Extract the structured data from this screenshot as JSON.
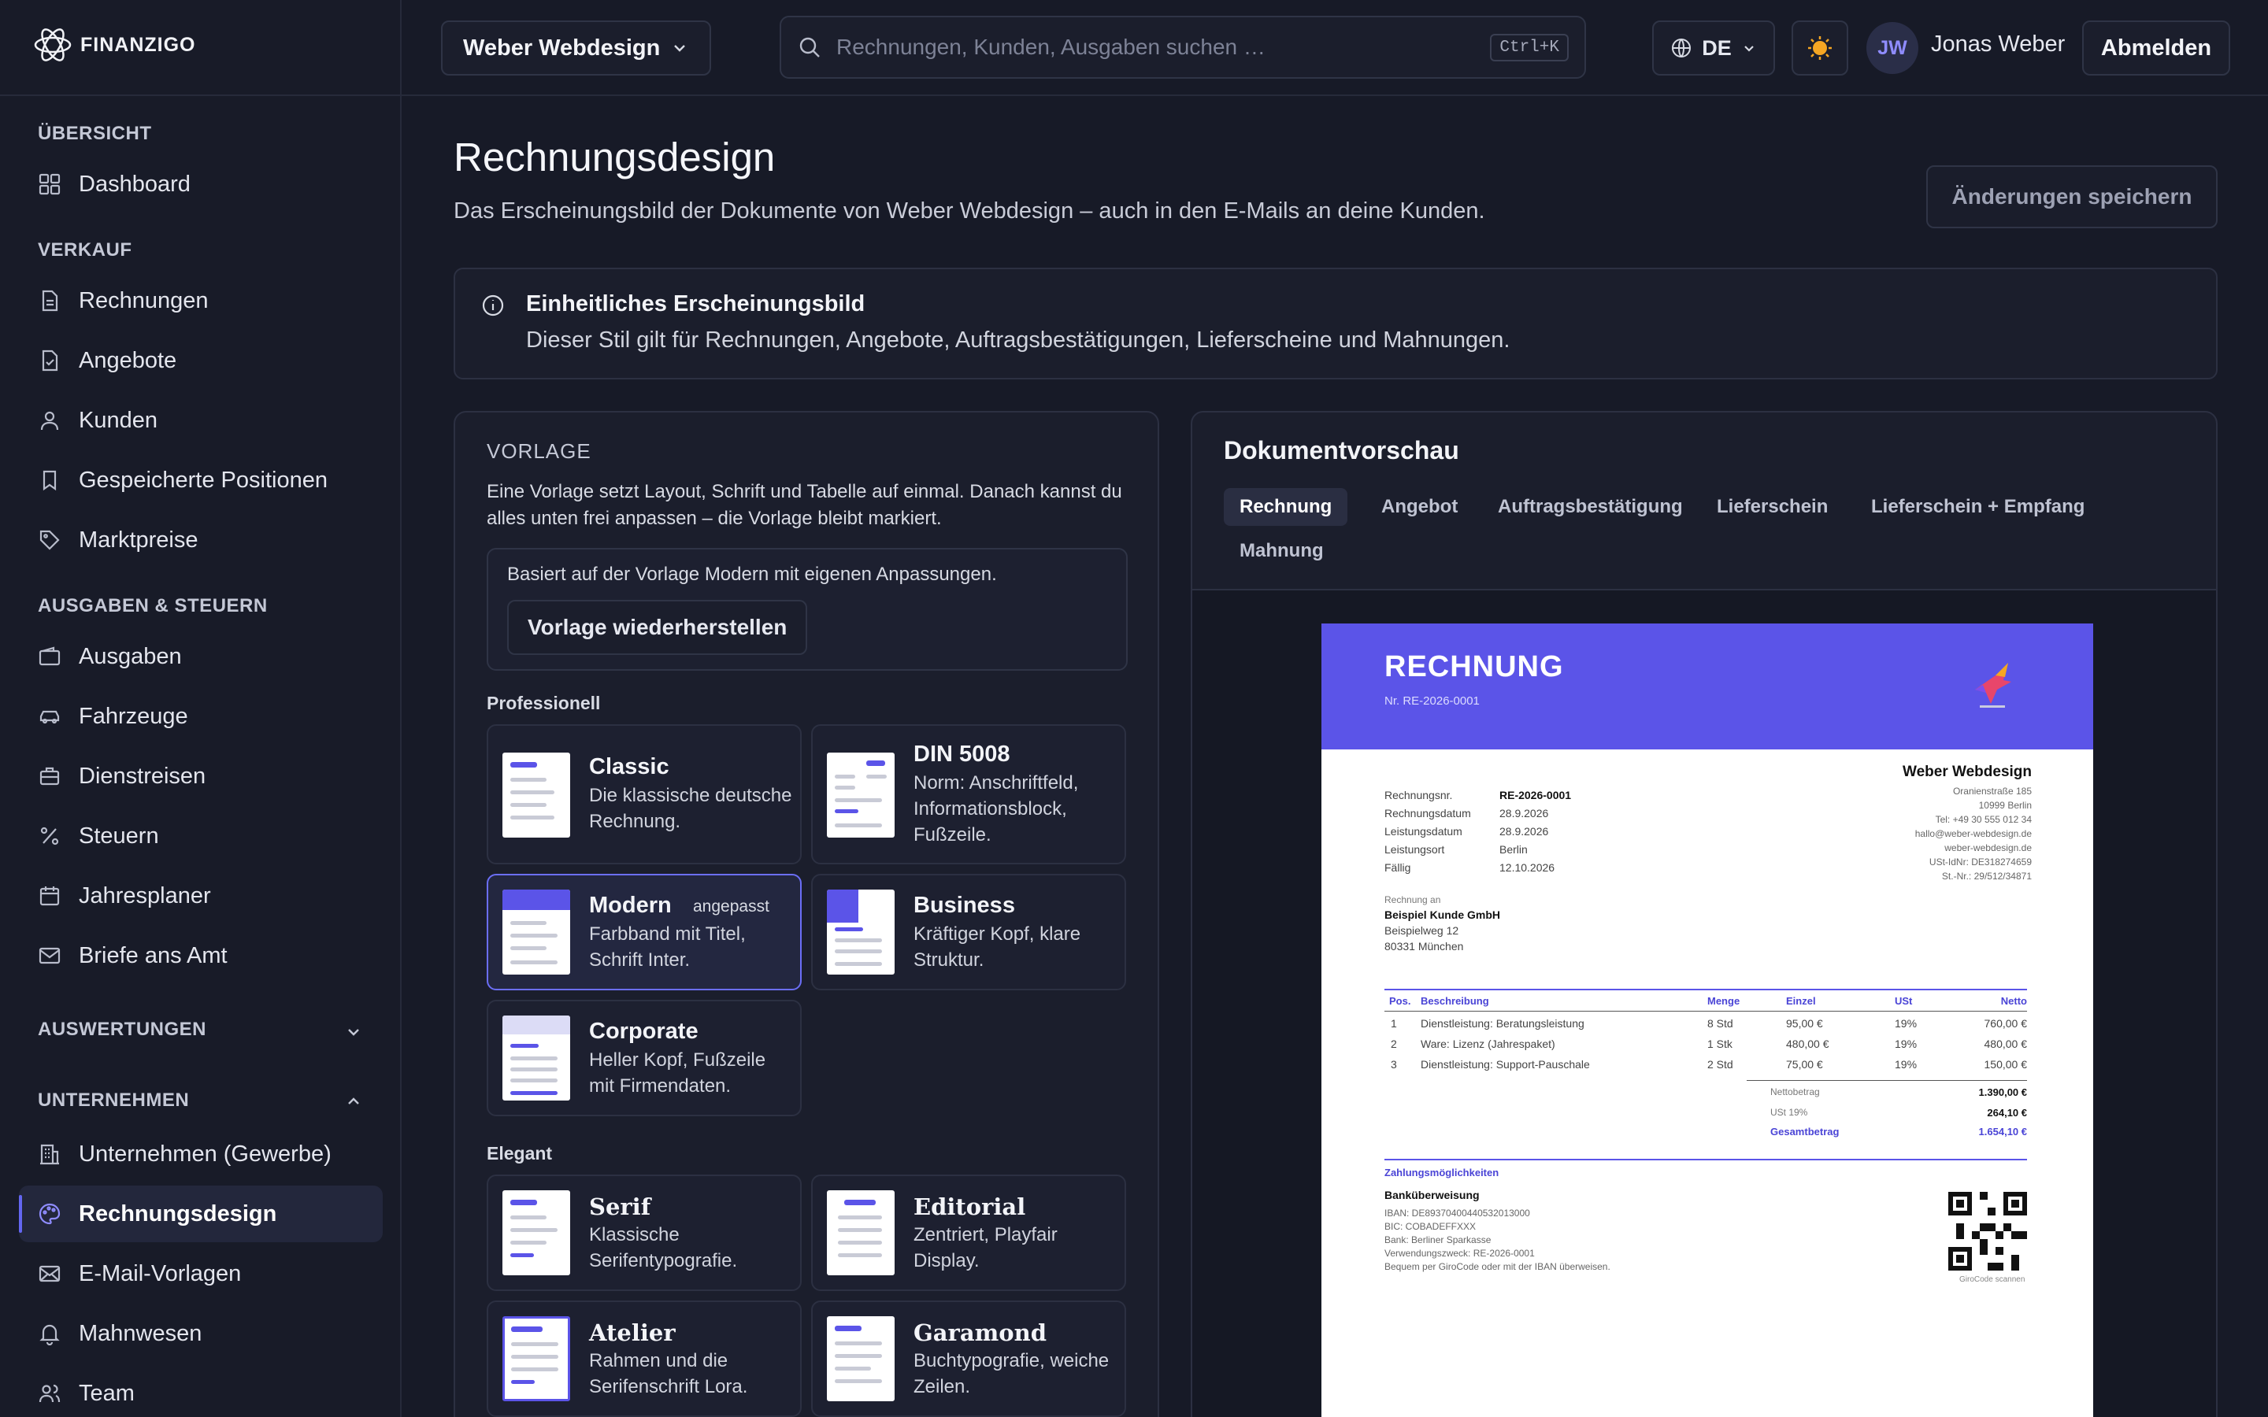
{
  "app": {
    "logo_text": "FINANZIGO"
  },
  "colors": {
    "accent": "#6366f1",
    "doc_header": "#5b54e8",
    "bg": "#171a27"
  },
  "sidebar": {
    "sections": {
      "overview": "ÜBERSICHT",
      "sales": "VERKAUF",
      "expenses": "AUSGABEN & STEUERN",
      "reports": "AUSWERTUNGEN",
      "company": "UNTERNEHMEN"
    },
    "items": {
      "dashboard": "Dashboard",
      "rechnungen": "Rechnungen",
      "angebote": "Angebote",
      "kunden": "Kunden",
      "positionen": "Gespeicherte Positionen",
      "marktpreise": "Marktpreise",
      "ausgaben": "Ausgaben",
      "fahrzeuge": "Fahrzeuge",
      "dienstreisen": "Dienstreisen",
      "steuern": "Steuern",
      "jahresplaner": "Jahresplaner",
      "briefe": "Briefe ans Amt",
      "unternehmen": "Unternehmen (Gewerbe)",
      "rechnungsdesign": "Rechnungsdesign",
      "email_vorlagen": "E-Mail-Vorlagen",
      "mahnwesen": "Mahnwesen",
      "team": "Team"
    }
  },
  "header": {
    "company": "Weber Webdesign",
    "search_placeholder": "Rechnungen, Kunden, Ausgaben suchen …",
    "shortcut": "Ctrl+K",
    "lang": "DE",
    "avatar_initials": "JW",
    "user_name": "Jonas Weber",
    "logout": "Abmelden"
  },
  "main": {
    "title": "Rechnungsdesign",
    "subtitle": "Das Erscheinungsbild der Dokumente von Weber Webdesign – auch in den E-Mails an deine Kunden.",
    "save": "Änderungen speichern",
    "info_title": "Einheitliches Erscheinungsbild",
    "info_text": "Dieser Stil gilt für Rechnungen, Angebote, Auftragsbestätigungen, Lieferscheine und Mahnungen."
  },
  "vorlage": {
    "heading": "VORLAGE",
    "text": "Eine Vorlage setzt Layout, Schrift und Tabelle auf einmal. Danach kannst du alles unten frei anpassen – die Vorlage bleibt markiert.",
    "based_on": "Basiert auf der Vorlage Modern mit eigenen Anpassungen.",
    "restore": "Vorlage wiederherstellen",
    "group_pro": "Professionell",
    "group_elegant": "Elegant",
    "cards": {
      "classic": {
        "name": "Classic",
        "desc": "Die klassische deutsche Rechnung."
      },
      "din": {
        "name": "DIN 5008",
        "desc": "Norm: Anschriftfeld, Informationsblock, Fußzeile."
      },
      "modern": {
        "name": "Modern",
        "badge": "angepasst",
        "desc": "Farbband mit Titel, Schrift Inter."
      },
      "business": {
        "name": "Business",
        "desc": "Kräftiger Kopf, klare Struktur."
      },
      "corporate": {
        "name": "Corporate",
        "desc": "Heller Kopf, Fußzeile mit Firmendaten."
      },
      "serif": {
        "name": "Serif",
        "desc": "Klassische Serifentypografie."
      },
      "editorial": {
        "name": "Editorial",
        "desc": "Zentriert, Playfair Display."
      },
      "atelier": {
        "name": "Atelier",
        "desc": "Rahmen und die Serifenschrift Lora."
      },
      "garamond": {
        "name": "Garamond",
        "desc": "Buchtypografie, weiche Zeilen."
      }
    }
  },
  "preview": {
    "title": "Dokumentvorschau",
    "tabs": [
      "Rechnung",
      "Angebot",
      "Auftragsbestätigung",
      "Lieferschein",
      "Lieferschein + Empfang",
      "Mahnung"
    ],
    "doc": {
      "title": "RECHNUNG",
      "nr": "Nr. RE-2026-0001",
      "company": "Weber Webdesign",
      "address": [
        "Oranienstraße 185",
        "10999 Berlin",
        "Tel: +49 30 555 012 34",
        "hallo@weber-webdesign.de",
        "weber-webdesign.de",
        "USt-IdNr: DE318274659",
        "St.-Nr.: 29/512/34871"
      ],
      "meta": [
        [
          "Rechnungsnr.",
          "RE-2026-0001"
        ],
        [
          "Rechnungsdatum",
          "28.9.2026"
        ],
        [
          "Leistungsdatum",
          "28.9.2026"
        ],
        [
          "Leistungsort",
          "Berlin"
        ],
        [
          "Fällig",
          "12.10.2026"
        ]
      ],
      "bill_to_label": "Rechnung an",
      "bill_to": [
        "Beispiel Kunde GmbH",
        "Beispielweg 12",
        "80331 München"
      ],
      "table_head": [
        "Pos.",
        "Beschreibung",
        "Menge",
        "Einzel",
        "USt",
        "Netto"
      ],
      "rows": [
        [
          "1",
          "Dienstleistung: Beratungsleistung",
          "8 Std",
          "95,00 €",
          "19%",
          "760,00 €"
        ],
        [
          "2",
          "Ware: Lizenz (Jahrespaket)",
          "1 Stk",
          "480,00 €",
          "19%",
          "480,00 €"
        ],
        [
          "3",
          "Dienstleistung: Support-Pauschale",
          "2 Std",
          "75,00 €",
          "19%",
          "150,00 €"
        ]
      ],
      "totals": [
        [
          "Nettobetrag",
          "1.390,00 €"
        ],
        [
          "USt 19%",
          "264,10 €"
        ],
        [
          "Gesamtbetrag",
          "1.654,10 €"
        ]
      ],
      "pay_title": "Zahlungsmöglichkeiten",
      "bank_title": "Banküberweisung",
      "bank": [
        "IBAN: DE89370400440532013000",
        "BIC: COBADEFFXXX",
        "Bank: Berliner Sparkasse",
        "Verwendungszweck: RE-2026-0001",
        "Bequem per GiroCode oder mit der IBAN überweisen."
      ],
      "qr_caption": "GiroCode scannen"
    }
  }
}
